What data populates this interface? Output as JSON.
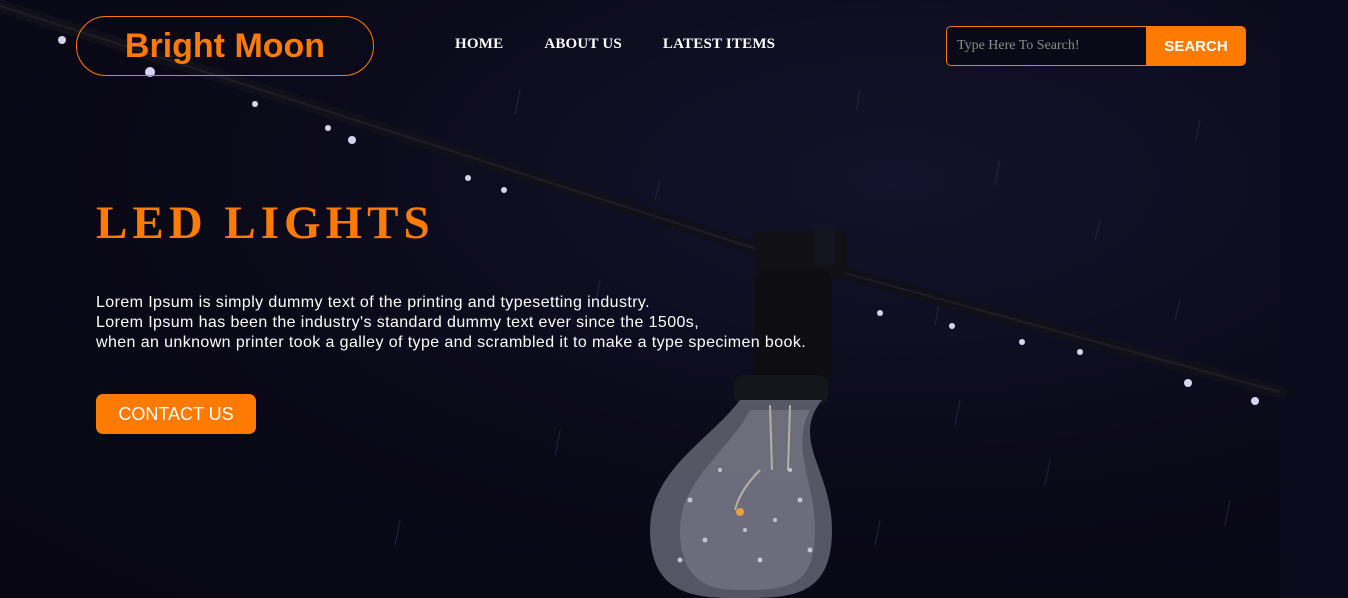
{
  "brand": {
    "name": "Bright Moon",
    "accent_color": "#ff7a00"
  },
  "nav": {
    "items": [
      {
        "label": "HOME"
      },
      {
        "label": "ABOUT US"
      },
      {
        "label": "LATEST ITEMS"
      }
    ]
  },
  "search": {
    "placeholder": "Type Here To Search!",
    "value": "",
    "button_label": "SEARCH"
  },
  "hero": {
    "title": "LED LIGHTS",
    "lines": [
      "Lorem Ipsum is simply dummy text of the printing and typesetting industry.",
      "Lorem Ipsum has been the industry's standard dummy text ever since the 1500s,",
      "when an unknown printer took a galley of type and scrambled it to make a type specimen book."
    ],
    "cta_label": "CONTACT US",
    "background": "string-light-bulb-rain-photo"
  }
}
